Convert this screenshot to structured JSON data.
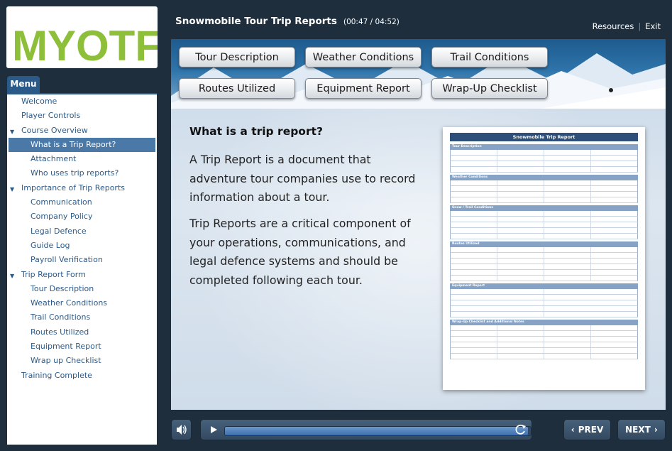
{
  "logo": {
    "text": "MYOTF"
  },
  "menu": {
    "tab_label": "Menu",
    "items": [
      {
        "label": "Welcome",
        "level": 0,
        "expander": false,
        "selected": false
      },
      {
        "label": "Player Controls",
        "level": 0,
        "expander": false,
        "selected": false
      },
      {
        "label": "Course Overview",
        "level": 0,
        "expander": true,
        "selected": false
      },
      {
        "label": "What is a Trip Report?",
        "level": 1,
        "expander": false,
        "selected": true
      },
      {
        "label": "Attachment",
        "level": 1,
        "expander": false,
        "selected": false
      },
      {
        "label": "Who uses trip reports?",
        "level": 1,
        "expander": false,
        "selected": false
      },
      {
        "label": "Importance of Trip Reports",
        "level": 0,
        "expander": true,
        "selected": false
      },
      {
        "label": "Communication",
        "level": 1,
        "expander": false,
        "selected": false
      },
      {
        "label": "Company Policy",
        "level": 1,
        "expander": false,
        "selected": false
      },
      {
        "label": "Legal Defence",
        "level": 1,
        "expander": false,
        "selected": false
      },
      {
        "label": "Guide Log",
        "level": 1,
        "expander": false,
        "selected": false
      },
      {
        "label": "Payroll Verification",
        "level": 1,
        "expander": false,
        "selected": false
      },
      {
        "label": "Trip Report Form",
        "level": 0,
        "expander": true,
        "selected": false
      },
      {
        "label": "Tour Description",
        "level": 1,
        "expander": false,
        "selected": false
      },
      {
        "label": "Weather Conditions",
        "level": 1,
        "expander": false,
        "selected": false
      },
      {
        "label": "Trail Conditions",
        "level": 1,
        "expander": false,
        "selected": false
      },
      {
        "label": "Routes Utilized",
        "level": 1,
        "expander": false,
        "selected": false
      },
      {
        "label": "Equipment Report",
        "level": 1,
        "expander": false,
        "selected": false
      },
      {
        "label": "Wrap up Checklist",
        "level": 1,
        "expander": false,
        "selected": false
      },
      {
        "label": "Training Complete",
        "level": 0,
        "expander": false,
        "selected": false
      }
    ]
  },
  "header": {
    "title": "Snowmobile Tour Trip Reports",
    "time": "(00:47 / 04:52)",
    "resources": "Resources",
    "exit": "Exit"
  },
  "nav_buttons": [
    "Tour Description",
    "Weather Conditions",
    "Trail Conditions",
    "Routes Utilized",
    "Equipment Report",
    "Wrap-Up Checklist"
  ],
  "content": {
    "heading": "What is a trip report?",
    "p1": "A Trip Report is a document that adventure tour companies use to record information about a tour.",
    "p2": "Trip Reports are a critical component of your operations, communications, and legal defence systems and should be completed following each tour."
  },
  "document": {
    "title": "Snowmobile Trip Report",
    "sections": [
      "Tour Description",
      "Weather Conditions",
      "Snow / Trail Conditions",
      "Routes Utilized",
      "Equipment Report",
      "Wrap-Up Checklist and Additional Notes"
    ]
  },
  "controls": {
    "prev": "PREV",
    "next": "NEXT",
    "progress_fraction": 0.99
  },
  "colors": {
    "accent": "#2c5a88",
    "background": "#1e2e3d"
  },
  "icons": {
    "volume": "speaker-icon",
    "play": "play-icon",
    "replay": "replay-icon",
    "prev": "chevron-left-icon",
    "next": "chevron-right-icon",
    "expander": "triangle-down-icon"
  }
}
